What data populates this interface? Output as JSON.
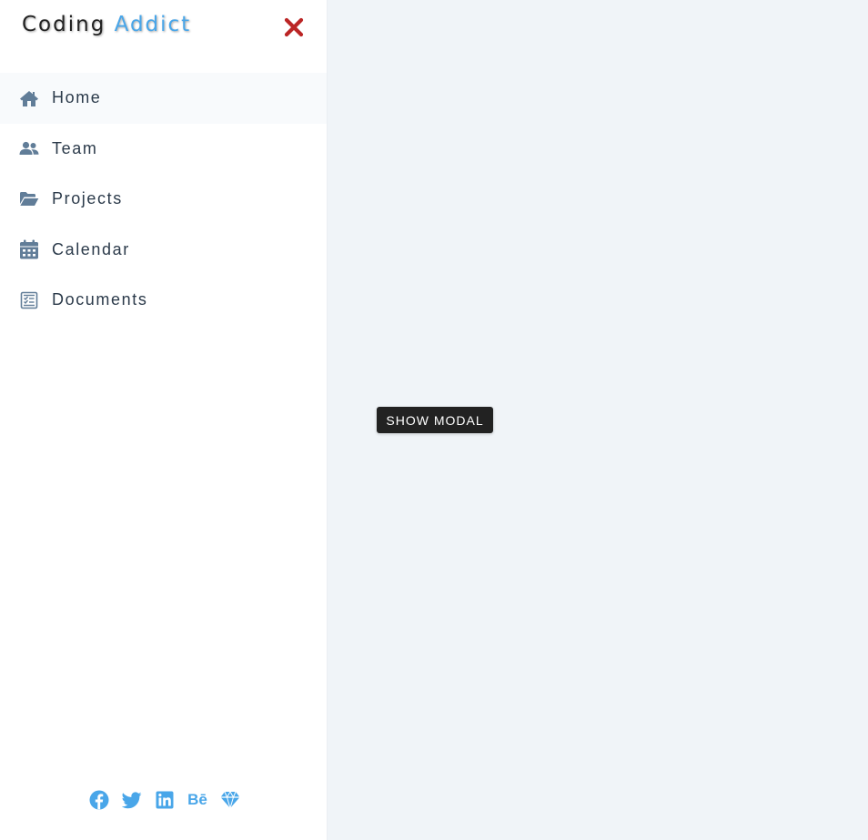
{
  "sidebar": {
    "logo": {
      "part1": "Coding ",
      "part2": "Addict"
    },
    "close_icon": "close-icon",
    "items": [
      {
        "label": "Home",
        "icon": "home-icon",
        "active": true
      },
      {
        "label": "Team",
        "icon": "team-icon",
        "active": false
      },
      {
        "label": "Projects",
        "icon": "folder-open-icon",
        "active": false
      },
      {
        "label": "Calendar",
        "icon": "calendar-icon",
        "active": false
      },
      {
        "label": "Documents",
        "icon": "document-icon",
        "active": false
      }
    ],
    "socials": [
      {
        "icon": "facebook-icon"
      },
      {
        "icon": "twitter-icon"
      },
      {
        "icon": "linkedin-icon"
      },
      {
        "icon": "behance-icon",
        "text": "Bē"
      },
      {
        "icon": "sketch-icon"
      }
    ]
  },
  "main": {
    "show_modal_label": "SHOW MODAL"
  },
  "colors": {
    "accent": "#49a6e9",
    "close": "#bb2525",
    "nav_icon": "#617d98",
    "nav_text": "#2b3a4a",
    "background": "#f0f4f8",
    "button_bg": "#222222"
  }
}
